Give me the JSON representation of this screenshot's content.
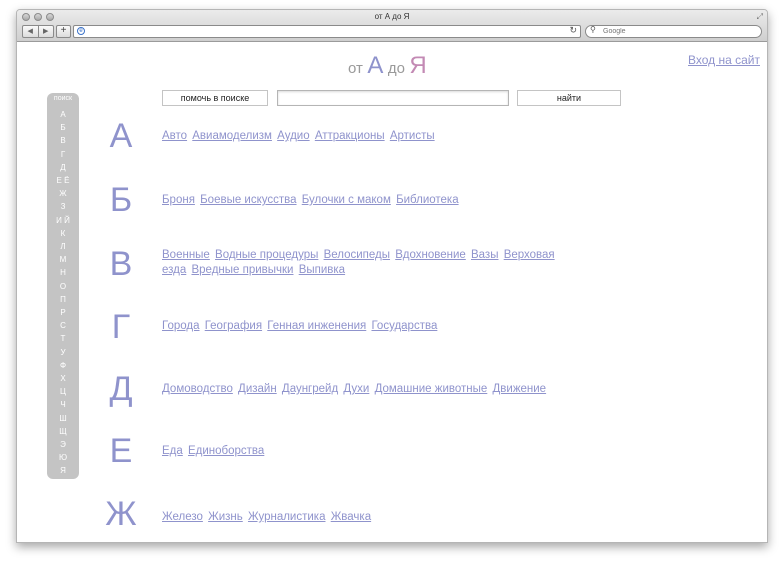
{
  "window": {
    "title": "от А до Я",
    "search_placeholder": "Google"
  },
  "site": {
    "logo_from": "от",
    "logo_a": "А",
    "logo_to": "до",
    "logo_ya": "Я",
    "login": "Вход на сайт",
    "help_button": "помочь в поиске",
    "find_button": "найти"
  },
  "sidebar": {
    "search_label": "поиск",
    "letters": [
      "А",
      "Б",
      "В",
      "Г",
      "Д",
      "Е Ё",
      "Ж",
      "З",
      "И Й",
      "К",
      "Л",
      "М",
      "Н",
      "О",
      "П",
      "Р",
      "С",
      "Т",
      "У",
      "Ф",
      "Х",
      "Ц",
      "Ч",
      "Ш",
      "Щ",
      "Э",
      "Ю",
      "Я"
    ]
  },
  "sections": [
    {
      "letter": "А",
      "items": [
        "Авто",
        "Авиамоделизм",
        "Аудио",
        "Аттракционы",
        "Артисты"
      ]
    },
    {
      "letter": "Б",
      "items": [
        "Броня",
        "Боевые искусства",
        "Булочки с маком",
        "Библиотека"
      ]
    },
    {
      "letter": "В",
      "items": [
        "Военные",
        "Водные процедуры",
        "Велосипеды",
        "Вдохновение",
        "Вазы",
        "Верховая езда",
        "Вредные привычки",
        "Выпивка"
      ]
    },
    {
      "letter": "Г",
      "items": [
        "Города",
        "География",
        "Генная инженения",
        "Государства"
      ]
    },
    {
      "letter": "Д",
      "items": [
        "Домоводство",
        "Дизайн",
        "Даунгрейд",
        "Духи",
        "Домашние животные",
        "Движение"
      ]
    },
    {
      "letter": "Е",
      "items": [
        "Еда",
        "Единоборства"
      ]
    },
    {
      "letter": "Ж",
      "items": [
        "Железо",
        "Жизнь",
        "Журналистика",
        "Жвачка"
      ]
    }
  ],
  "colors": {
    "accent": "#8f93cc",
    "accent_alt": "#c38ab4",
    "sidebar_bg": "#c4c4c4"
  }
}
